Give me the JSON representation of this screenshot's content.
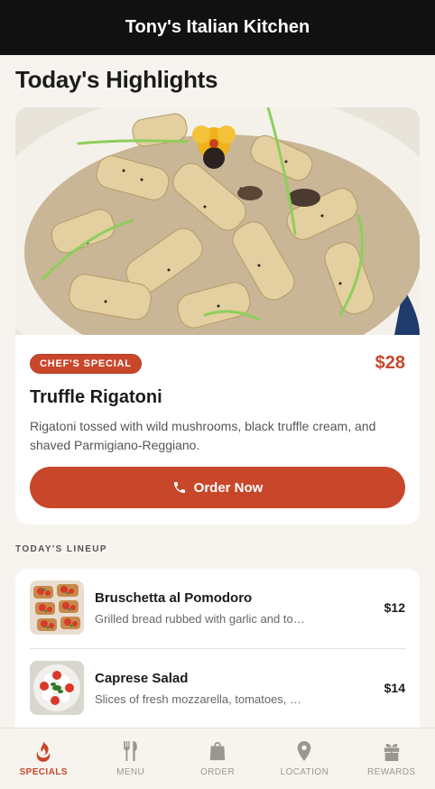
{
  "header": {
    "title": "Tony's Italian Kitchen"
  },
  "highlights": {
    "title": "Today's Highlights",
    "featured": {
      "badge": "CHEF'S SPECIAL",
      "price": "$28",
      "name": "Truffle Rigatoni",
      "description": "Rigatoni tossed with wild mushrooms, black truffle cream, and shaved Parmigiano-Reggiano.",
      "order_label": "Order Now"
    }
  },
  "lineup": {
    "label": "TODAY'S LINEUP",
    "items": [
      {
        "name": "Bruschetta al Pomodoro",
        "description": "Grilled bread rubbed with garlic and topped with fresh tomatoes and basil",
        "price": "$12"
      },
      {
        "name": "Caprese Salad",
        "description": "Slices of fresh mozzarella, tomatoes, and basil drizzled with olive oil",
        "price": "$14"
      }
    ]
  },
  "tabs": [
    {
      "label": "SPECIALS",
      "icon": "flame-icon",
      "active": true
    },
    {
      "label": "MENU",
      "icon": "fork-knife-icon",
      "active": false
    },
    {
      "label": "ORDER",
      "icon": "shopping-bag-icon",
      "active": false
    },
    {
      "label": "LOCATION",
      "icon": "map-pin-icon",
      "active": false
    },
    {
      "label": "REWARDS",
      "icon": "gift-icon",
      "active": false
    }
  ],
  "colors": {
    "accent": "#c8472b",
    "header_bg": "#111111",
    "page_bg": "#f7f4ef"
  }
}
